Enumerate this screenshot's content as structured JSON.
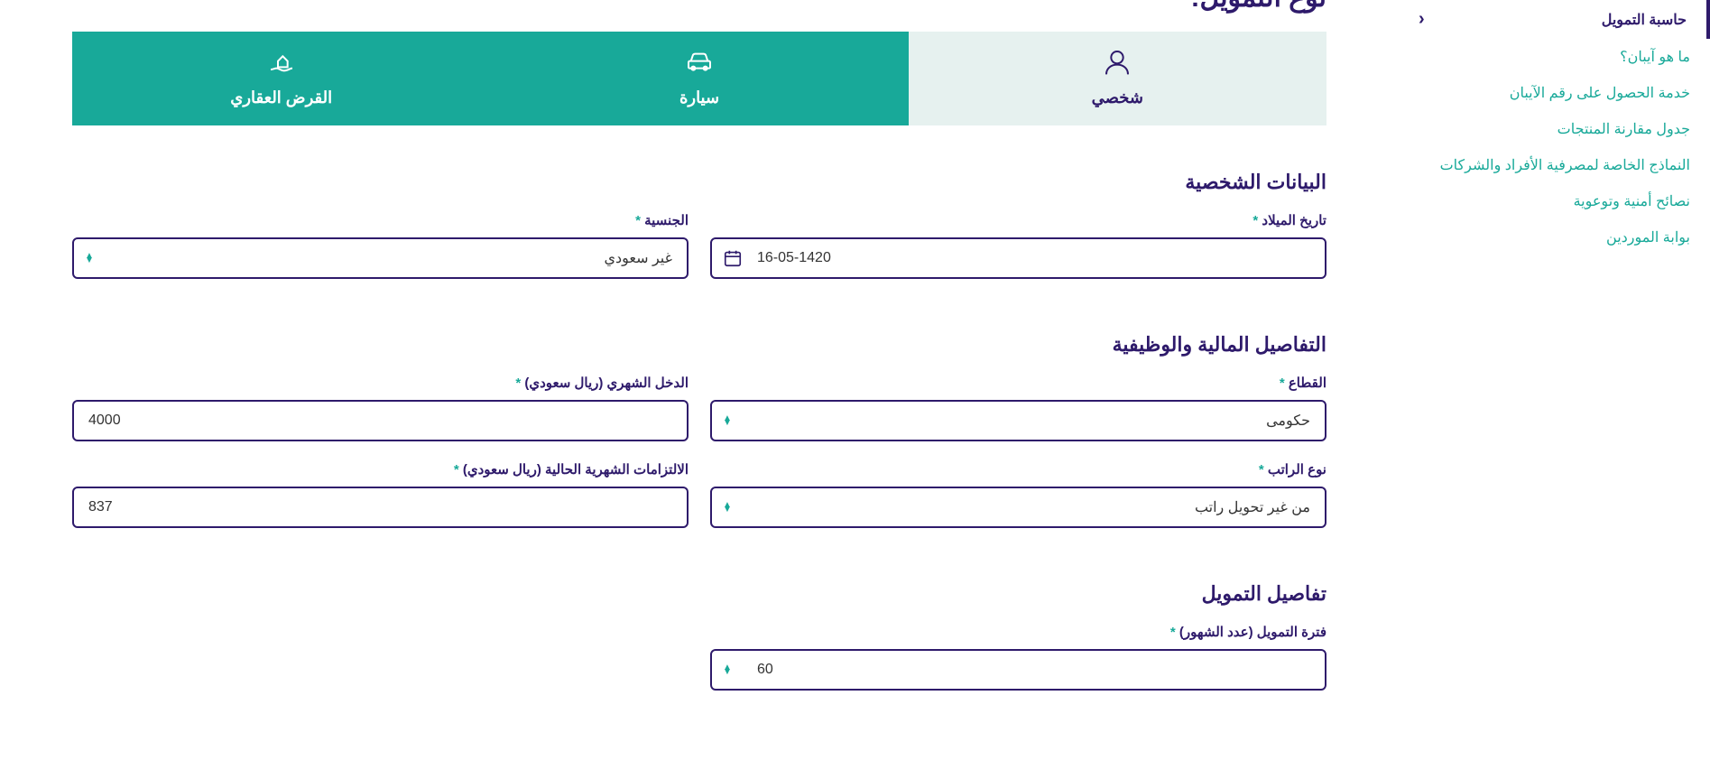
{
  "sidebar": {
    "items": [
      {
        "label": "حاسبة التمويل",
        "active": true
      },
      {
        "label": "ما هو آيبان؟",
        "active": false
      },
      {
        "label": "خدمة الحصول على رقم الآيبان",
        "active": false
      },
      {
        "label": "جدول مقارنة المنتجات",
        "active": false
      },
      {
        "label": "النماذج الخاصة لمصرفية الأفراد والشركات",
        "active": false
      },
      {
        "label": "نصائح أمنية وتوعوية",
        "active": false
      },
      {
        "label": "بوابة الموردين",
        "active": false
      }
    ]
  },
  "page_title": "نوع التمويل:",
  "tabs": {
    "personal": "شخصي",
    "car": "سيارة",
    "mortgage": "القرض العقاري"
  },
  "sections": {
    "personal_data": "البيانات الشخصية",
    "financial_job": "التفاصيل المالية والوظيفية",
    "financing_details": "تفاصيل التمويل"
  },
  "fields": {
    "dob": {
      "label": "تاريخ الميلاد",
      "value": "16-05-1420"
    },
    "nationality": {
      "label": "الجنسية",
      "value": "غير سعودي"
    },
    "sector": {
      "label": "القطاع",
      "value": "حكومى"
    },
    "monthly_income": {
      "label": "الدخل الشهري (ريال سعودي)",
      "value": "4000"
    },
    "salary_type": {
      "label": "نوع الراتب",
      "value": "من غير تحويل راتب"
    },
    "obligations": {
      "label": "الالتزامات الشهرية الحالية (ريال سعودي)",
      "value": "837"
    },
    "period": {
      "label": "فترة التمويل (عدد الشهور)",
      "value": "60"
    }
  },
  "required_mark": " *"
}
